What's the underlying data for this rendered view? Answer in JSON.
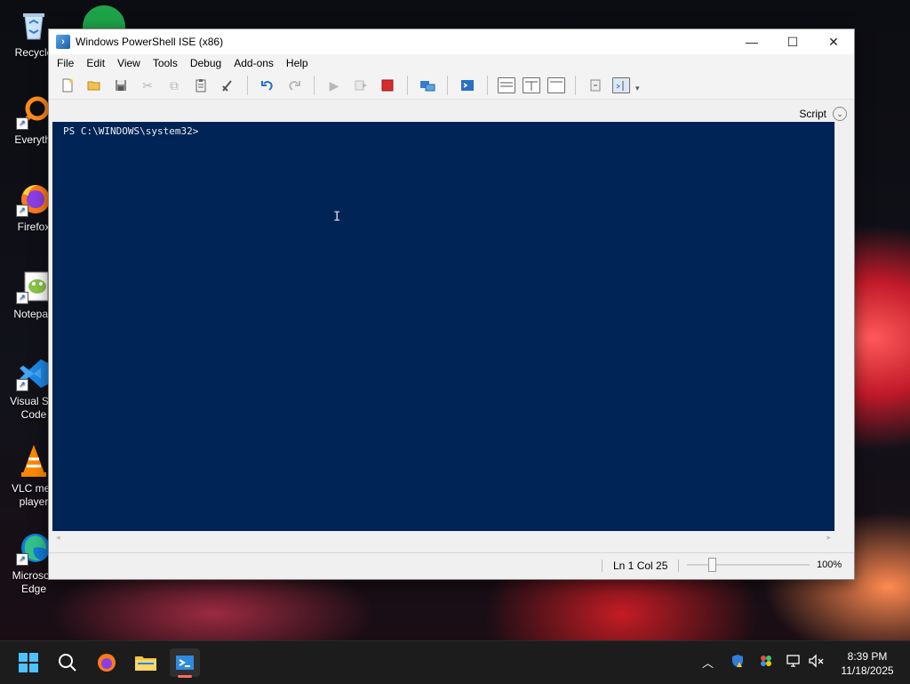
{
  "desktop": {
    "icons": [
      {
        "label": "Recycle"
      },
      {
        "label": "Everythi"
      },
      {
        "label": "Firefox"
      },
      {
        "label": "Notepad"
      },
      {
        "label": "Visual Stu Code"
      },
      {
        "label": "VLC med player"
      },
      {
        "label": "Microsoft Edge"
      }
    ]
  },
  "window": {
    "title": "Windows PowerShell ISE (x86)",
    "menu": [
      "File",
      "Edit",
      "View",
      "Tools",
      "Debug",
      "Add-ons",
      "Help"
    ],
    "script_label": "Script",
    "console_line": "PS C:\\WINDOWS\\system32>",
    "status": {
      "position": "Ln 1  Col 25",
      "zoom": "100%"
    }
  },
  "taskbar": {
    "time": "8:39 PM",
    "date": "11/18/2025"
  },
  "colors": {
    "console_bg": "#012456",
    "console_fg": "#eeedf0",
    "taskbar_bg": "#1c1c1c",
    "accent": "#0078d4"
  }
}
